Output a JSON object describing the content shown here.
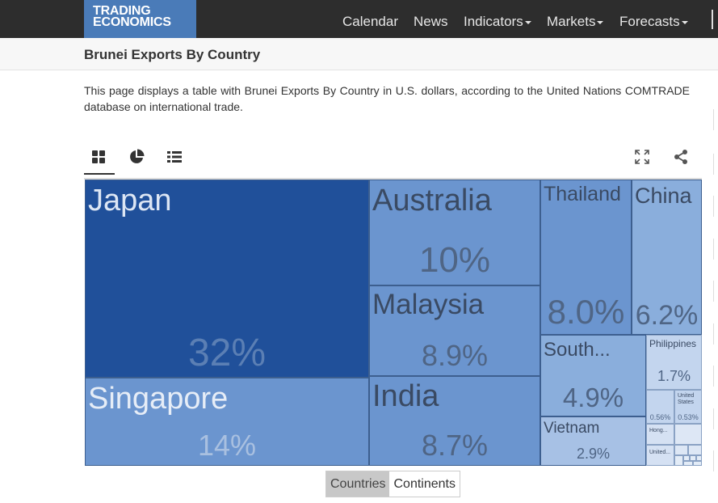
{
  "logo": {
    "line1": "TRADING",
    "line2": "ECONOMICS"
  },
  "nav": [
    {
      "label": "Calendar",
      "dropdown": false
    },
    {
      "label": "News",
      "dropdown": false
    },
    {
      "label": "Indicators",
      "dropdown": true
    },
    {
      "label": "Markets",
      "dropdown": true
    },
    {
      "label": "Forecasts",
      "dropdown": true
    }
  ],
  "page": {
    "title": "Brunei Exports By Country",
    "description": "This page displays a table with Brunei Exports By Country in U.S. dollars, according to the United Nations COMTRADE database on international trade."
  },
  "toolbar": {
    "icons": [
      "treemap-icon",
      "pie-chart-icon",
      "list-icon",
      "expand-icon",
      "share-icon"
    ]
  },
  "treemap": {
    "colors": {
      "dark": "#20509a",
      "mid": "#6b95cf",
      "light": "#8aaedc",
      "lighter": "#a7c1e5",
      "lightest": "#c3d5ee"
    },
    "cells": [
      {
        "name": "Japan",
        "pct": "32%"
      },
      {
        "name": "Singapore",
        "pct": "14%"
      },
      {
        "name": "Australia",
        "pct": "10%"
      },
      {
        "name": "Malaysia",
        "pct": "8.9%"
      },
      {
        "name": "India",
        "pct": "8.7%"
      },
      {
        "name": "Thailand",
        "pct": "8.0%"
      },
      {
        "name": "China",
        "pct": "6.2%"
      },
      {
        "name": "South...",
        "pct": "4.9%"
      },
      {
        "name": "Vietnam",
        "pct": "2.9%"
      },
      {
        "name": "Philippines",
        "pct": "1.7%"
      },
      {
        "name": "",
        "pct": "0.56%"
      },
      {
        "name": "United States",
        "pct": "0.53%"
      },
      {
        "name": "Hong...",
        "pct": ""
      },
      {
        "name": "United...",
        "pct": ""
      }
    ]
  },
  "toggle": {
    "countries": "Countries",
    "continents": "Continents"
  }
}
